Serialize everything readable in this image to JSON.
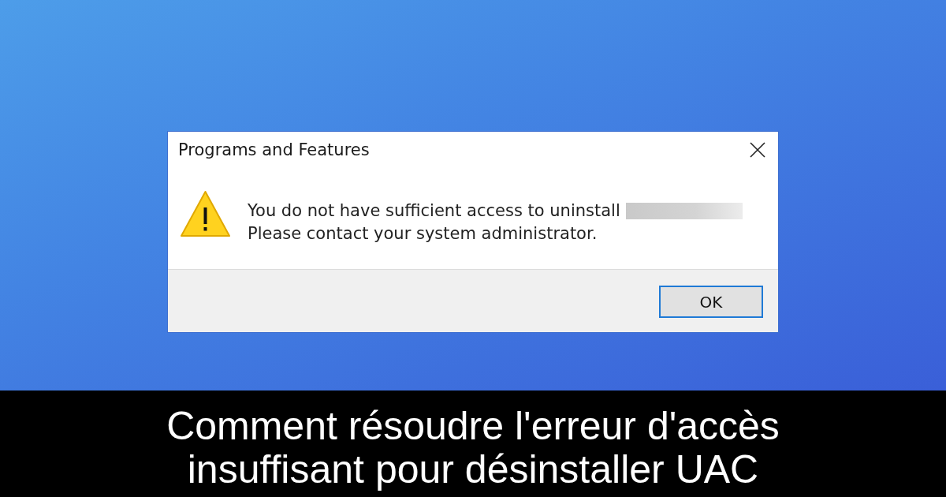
{
  "dialog": {
    "title": "Programs and Features",
    "message": [
      "You do not have sufficient access to uninstall",
      "Please contact your system administrator."
    ],
    "buttons": [
      {
        "label": "OK",
        "default": true
      }
    ]
  },
  "caption": "Comment résoudre l'erreur d'accès insuffisant pour désinstaller UAC"
}
